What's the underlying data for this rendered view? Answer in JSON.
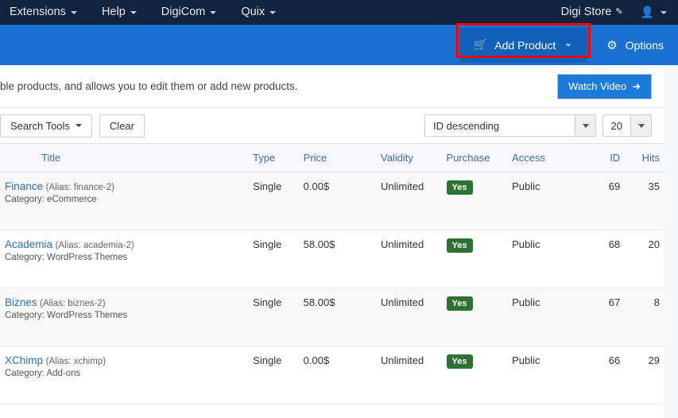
{
  "topbar": {
    "menu": [
      {
        "label": "Extensions",
        "has_caret": true
      },
      {
        "label": "Help",
        "has_caret": true
      },
      {
        "label": "DigiCom",
        "has_caret": true
      },
      {
        "label": "Quix",
        "has_caret": true
      }
    ],
    "store_link": "Digi Store",
    "store_icon": "external-link-icon",
    "user_icon": "user-icon"
  },
  "toolbar": {
    "add_product_label": "Add Product",
    "add_product_icon": "cart-icon",
    "options_label": "Options",
    "options_icon": "gear-icon",
    "highlight_color": "#ff0000",
    "bar_color": "#1a71d1",
    "button_color": "#1160ba"
  },
  "description": {
    "text": "ble products, and allows you to edit them or add new products.",
    "watch_video_label": "Watch Video",
    "watch_video_icon": "arrow-right-icon"
  },
  "filters": {
    "search_tools_label": "Search Tools",
    "clear_label": "Clear",
    "sort_value": "ID descending",
    "limit_value": "20"
  },
  "table": {
    "columns": [
      {
        "key": "title",
        "label": "Title",
        "active": false
      },
      {
        "key": "type",
        "label": "Type",
        "active": false
      },
      {
        "key": "price",
        "label": "Price",
        "active": false
      },
      {
        "key": "validity",
        "label": "Validity",
        "active": true
      },
      {
        "key": "purchase",
        "label": "Purchase",
        "active": false
      },
      {
        "key": "access",
        "label": "Access",
        "active": false
      },
      {
        "key": "id",
        "label": "ID",
        "active": false
      },
      {
        "key": "hits",
        "label": "Hits",
        "active": false
      }
    ],
    "rows": [
      {
        "title": "Finance",
        "alias": "(Alias: finance-2)",
        "category": "Category: eCommerce",
        "type": "Single",
        "price": "0.00$",
        "validity": "Unlimited",
        "purchase": "Yes",
        "access": "Public",
        "id": "69",
        "hits": "35"
      },
      {
        "title": "Academia",
        "alias": "(Alias: academia-2)",
        "category": "Category: WordPress Themes",
        "type": "Single",
        "price": "58.00$",
        "validity": "Unlimited",
        "purchase": "Yes",
        "access": "Public",
        "id": "68",
        "hits": "20"
      },
      {
        "title": "Biznes",
        "alias": "(Alias: biznes-2)",
        "category": "Category: WordPress Themes",
        "type": "Single",
        "price": "58.00$",
        "validity": "Unlimited",
        "purchase": "Yes",
        "access": "Public",
        "id": "67",
        "hits": "8"
      },
      {
        "title": "XChimp",
        "alias": "(Alias: xchimp)",
        "category": "Category: Add-ons",
        "type": "Single",
        "price": "0.00$",
        "validity": "Unlimited",
        "purchase": "Yes",
        "access": "Public",
        "id": "66",
        "hits": "29"
      }
    ]
  },
  "colors": {
    "topbar_bg": "#12233f",
    "accent_blue": "#1a71d1",
    "link_blue": "#2b6cb0",
    "badge_green": "#2e7233"
  }
}
